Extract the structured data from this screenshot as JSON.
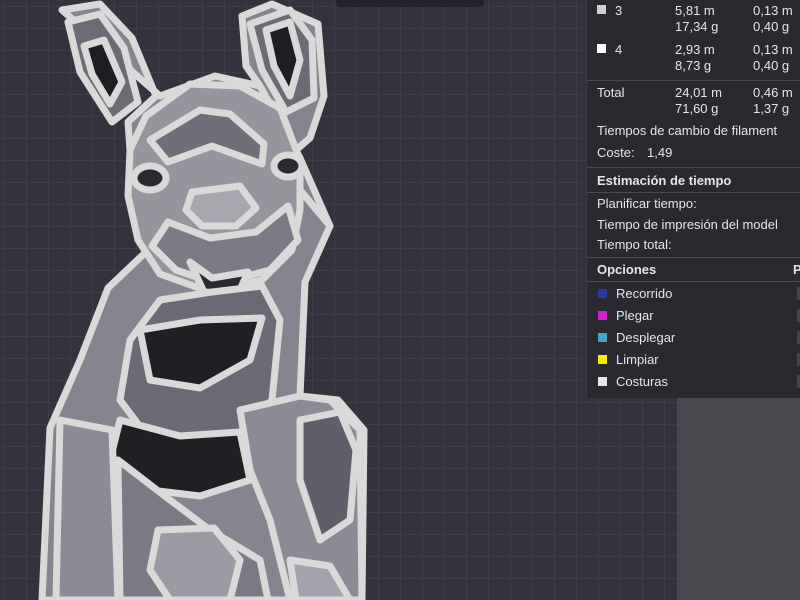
{
  "filament_table": {
    "rows": [
      {
        "label": "3",
        "swatch": "#cfcfcf",
        "length": "5,81 m",
        "weight": "17,34 g",
        "extra_length": "0,13 m",
        "extra_weight": "0,40 g"
      },
      {
        "label": "4",
        "swatch": "#ffffff",
        "length": "2,93 m",
        "weight": "8,73 g",
        "extra_length": "0,13 m",
        "extra_weight": "0,40 g"
      }
    ],
    "total": {
      "label": "Total",
      "length": "24,01 m",
      "weight": "71,60 g",
      "extra_length": "0,46 m",
      "extra_weight": "1,37 g"
    }
  },
  "filament_change_times_label": "Tiempos de cambio de filament",
  "cost": {
    "label": "Coste:",
    "value": "1,49"
  },
  "time_estimation": {
    "title": "Estimación de tiempo",
    "plan_label": "Planificar tiempo:",
    "model_print_label": "Tiempo de impresión del model",
    "total_label": "Tiempo total:"
  },
  "options": {
    "title": "Opciones",
    "right_header": "P",
    "items": [
      {
        "label": "Recorrido",
        "color": "#2e3aa3"
      },
      {
        "label": "Plegar",
        "color": "#d21fd2"
      },
      {
        "label": "Desplegar",
        "color": "#3fa6d0"
      },
      {
        "label": "Limpiar",
        "color": "#f0f000"
      },
      {
        "label": "Costuras",
        "color": "#e8e8e8"
      }
    ]
  },
  "colors": {
    "canvas_bg": "#34333d",
    "grid": "#4a4954",
    "panel_bg": "#2a292f"
  }
}
